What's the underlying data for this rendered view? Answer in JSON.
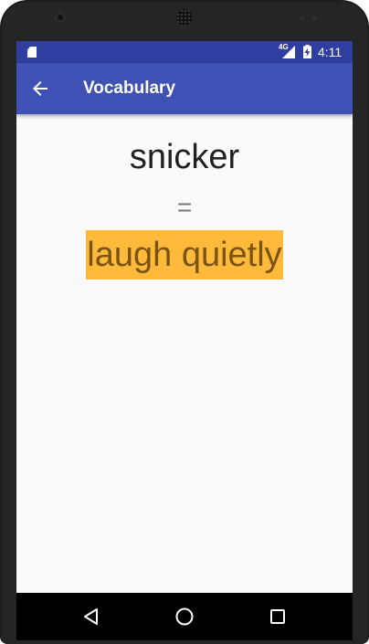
{
  "status_bar": {
    "network_type": "4G",
    "time": "4:11",
    "icons": [
      "sd-card-icon",
      "signal-icon",
      "battery-charging-icon"
    ]
  },
  "app_bar": {
    "title": "Vocabulary",
    "back_icon": "arrow-back-icon"
  },
  "flashcard": {
    "word": "snicker",
    "separator": "=",
    "meaning": "laugh quietly",
    "highlight_color": "#ffb93b"
  },
  "navigation_bar": {
    "buttons": [
      "back-triangle-icon",
      "home-circle-icon",
      "recents-square-icon"
    ]
  },
  "colors": {
    "status_bar": "#303f9f",
    "app_bar": "#3f51b5",
    "background": "#fafafa"
  }
}
